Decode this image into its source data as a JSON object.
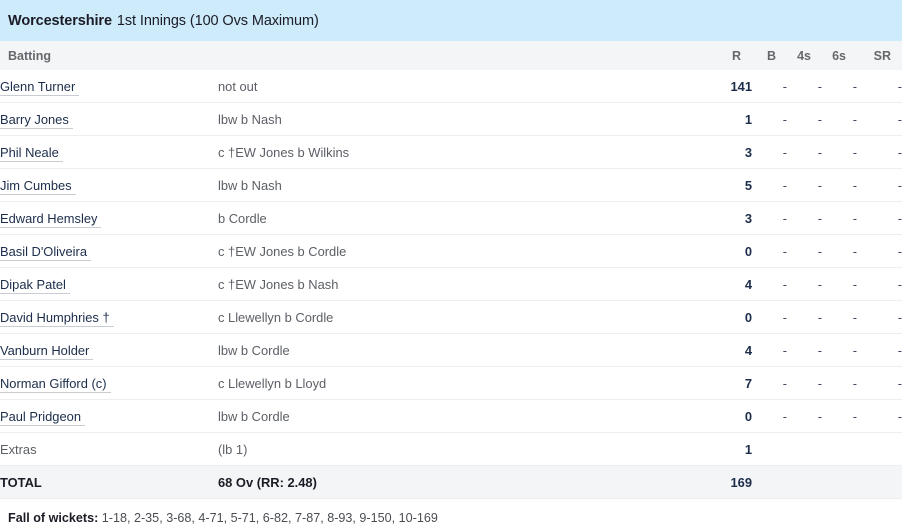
{
  "innings": {
    "team": "Worcestershire",
    "detail": "1st Innings (100 Ovs Maximum)"
  },
  "table": {
    "headers": {
      "batting": "Batting",
      "runs": "R",
      "balls": "B",
      "fours": "4s",
      "sixes": "6s",
      "strike_rate": "SR"
    },
    "dash": "-",
    "rows": [
      {
        "name": "Glenn Turner",
        "suffix": "",
        "dismissal": "not out",
        "r": "141",
        "b": "-",
        "fours": "-",
        "sixes": "-",
        "sr": "-"
      },
      {
        "name": "Barry Jones",
        "suffix": "",
        "dismissal": "lbw b Nash",
        "r": "1",
        "b": "-",
        "fours": "-",
        "sixes": "-",
        "sr": "-"
      },
      {
        "name": "Phil Neale",
        "suffix": "",
        "dismissal": "c †EW Jones b Wilkins",
        "r": "3",
        "b": "-",
        "fours": "-",
        "sixes": "-",
        "sr": "-"
      },
      {
        "name": "Jim Cumbes",
        "suffix": "",
        "dismissal": "lbw b Nash",
        "r": "5",
        "b": "-",
        "fours": "-",
        "sixes": "-",
        "sr": "-"
      },
      {
        "name": "Edward Hemsley",
        "suffix": "",
        "dismissal": "b Cordle",
        "r": "3",
        "b": "-",
        "fours": "-",
        "sixes": "-",
        "sr": "-"
      },
      {
        "name": "Basil D'Oliveira",
        "suffix": "",
        "dismissal": "c †EW Jones b Cordle",
        "r": "0",
        "b": "-",
        "fours": "-",
        "sixes": "-",
        "sr": "-"
      },
      {
        "name": "Dipak Patel",
        "suffix": "",
        "dismissal": "c †EW Jones b Nash",
        "r": "4",
        "b": "-",
        "fours": "-",
        "sixes": "-",
        "sr": "-"
      },
      {
        "name": "David Humphries †",
        "suffix": "",
        "dismissal": "c Llewellyn b Cordle",
        "r": "0",
        "b": "-",
        "fours": "-",
        "sixes": "-",
        "sr": "-"
      },
      {
        "name": "Vanburn Holder",
        "suffix": "",
        "dismissal": "lbw b Cordle",
        "r": "4",
        "b": "-",
        "fours": "-",
        "sixes": "-",
        "sr": "-"
      },
      {
        "name": "Norman Gifford (c)",
        "suffix": "",
        "dismissal": "c Llewellyn b Lloyd",
        "r": "7",
        "b": "-",
        "fours": "-",
        "sixes": "-",
        "sr": "-"
      },
      {
        "name": "Paul Pridgeon",
        "suffix": "",
        "dismissal": "lbw b Cordle",
        "r": "0",
        "b": "-",
        "fours": "-",
        "sixes": "-",
        "sr": "-"
      }
    ],
    "extras": {
      "label": "Extras",
      "detail": "(lb 1)",
      "value": "1"
    },
    "total": {
      "label": "TOTAL",
      "detail": "68 Ov (RR: 2.48)",
      "value": "169"
    }
  },
  "fall_of_wickets": {
    "label": "Fall of wickets:",
    "values": "1-18, 2-35, 3-68, 4-71, 5-71, 6-82, 7-87, 8-93, 9-150, 10-169"
  }
}
